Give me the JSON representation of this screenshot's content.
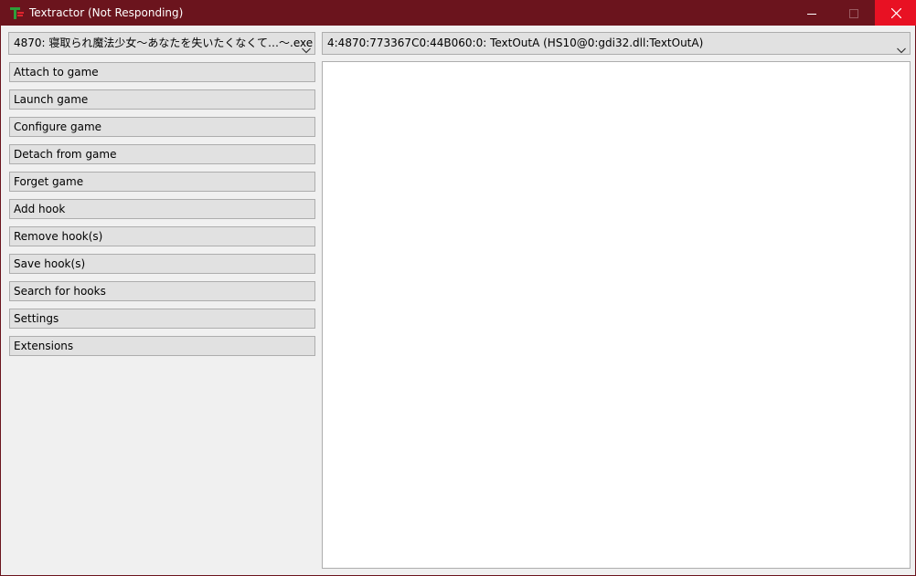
{
  "window": {
    "title": "Textractor (Not Responding)",
    "accent_color": "#6b141d",
    "close_hover_color": "#e81123"
  },
  "icons": {
    "app": "textractor-app-icon",
    "minimize": "minimize-icon",
    "maximize": "maximize-icon",
    "close": "close-icon",
    "dropdown": "chevron-down-icon"
  },
  "process_select": {
    "value": "4870: 寝取られ魔法少女～あなたを失いたくなくて…～.exe"
  },
  "hook_select": {
    "value": "4:4870:773367C0:44B060:0: TextOutA (HS10@0:gdi32.dll:TextOutA)"
  },
  "buttons": [
    {
      "label": "Attach to game"
    },
    {
      "label": "Launch game"
    },
    {
      "label": "Configure game"
    },
    {
      "label": "Detach from game"
    },
    {
      "label": "Forget game"
    },
    {
      "label": "Add hook"
    },
    {
      "label": "Remove hook(s)"
    },
    {
      "label": "Save hook(s)"
    },
    {
      "label": "Search for hooks"
    },
    {
      "label": "Settings"
    },
    {
      "label": "Extensions"
    }
  ],
  "output_text": ""
}
